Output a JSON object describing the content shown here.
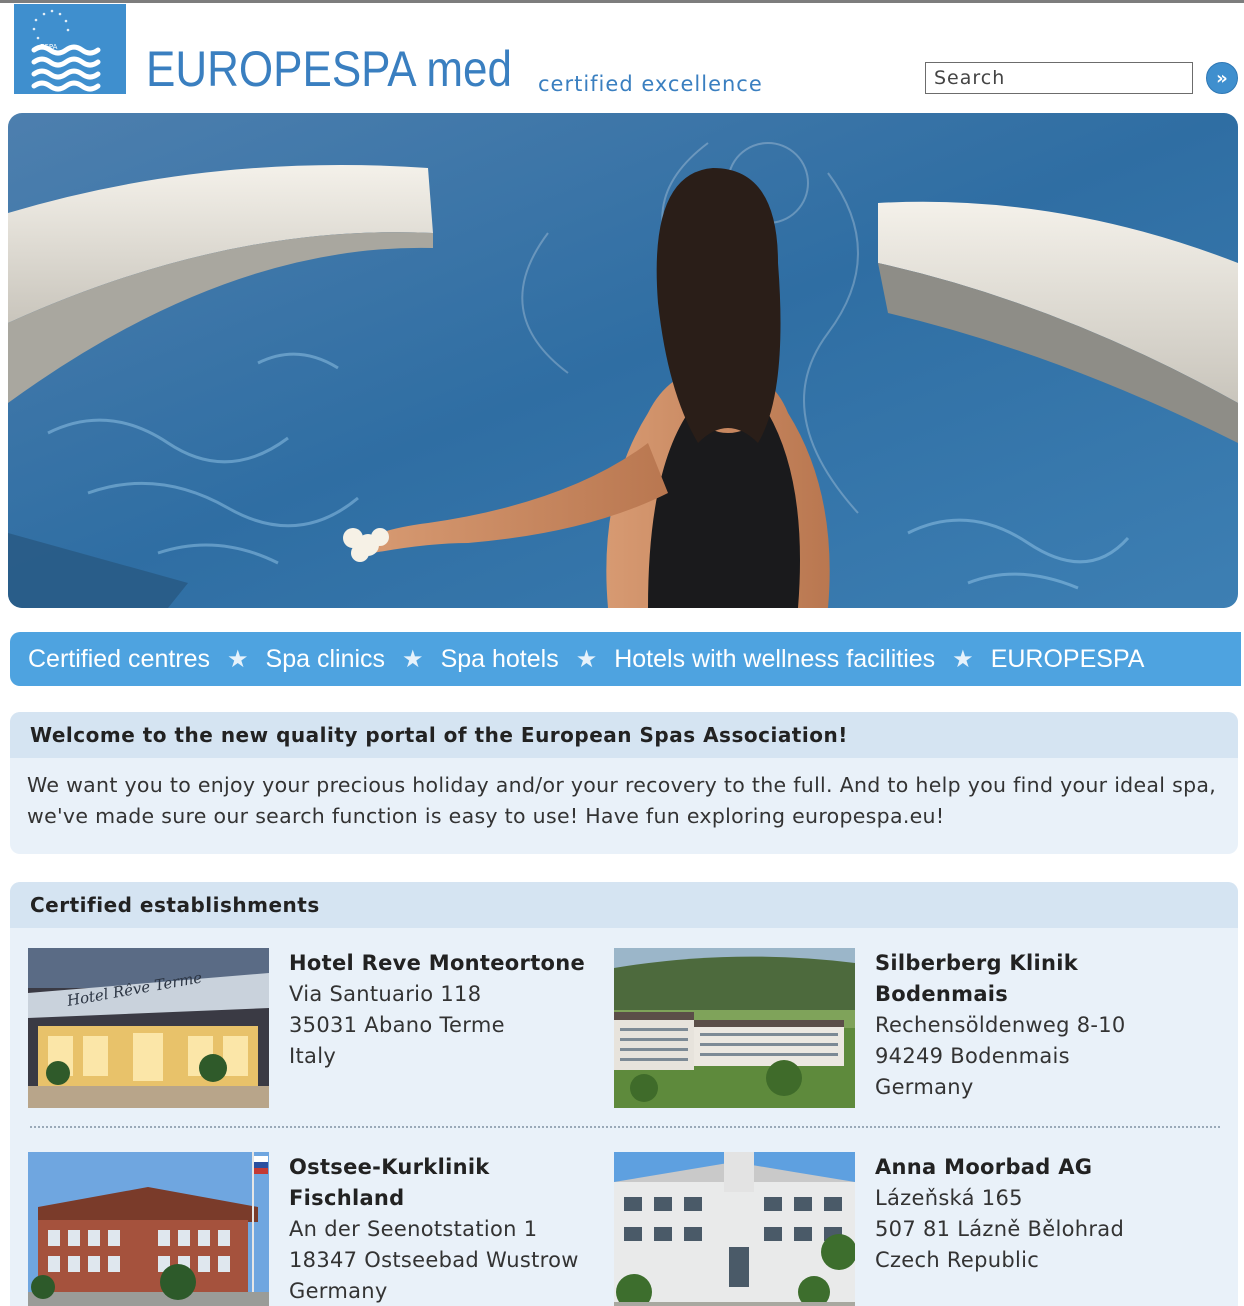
{
  "brand": {
    "title": "EUROPESPA med",
    "tagline": "certified excellence",
    "logo_text": "ESPA"
  },
  "search": {
    "placeholder": "Search",
    "button_label": "»"
  },
  "nav": {
    "items": [
      {
        "label": "Certified centres"
      },
      {
        "label": "Spa clinics"
      },
      {
        "label": "Spa hotels"
      },
      {
        "label": "Hotels with wellness facilities"
      },
      {
        "label": "EUROPESPA"
      }
    ],
    "separator": "★"
  },
  "welcome": {
    "heading": "Welcome to the new quality portal of the European Spas Association!",
    "body": "We want you to enjoy your precious holiday and/or your recovery to the full. And to help you find your ideal spa, we've made sure our search function is easy to use! Have fun exploring europespa.eu!"
  },
  "establishments": {
    "heading": "Certified establishments",
    "items": [
      {
        "name": "Hotel Reve Monteortone",
        "lines": [
          "Via Santuario 118",
          "35031 Abano Terme",
          "Italy"
        ],
        "sign_text": "Hotel Rêve Terme"
      },
      {
        "name": "Silberberg Klinik Bodenmais",
        "lines": [
          "Rechensöldenweg 8-10",
          "94249 Bodenmais",
          "Germany"
        ]
      },
      {
        "name": "Ostsee-Kurklinik Fischland",
        "lines": [
          "An der Seenotstation 1",
          "18347 Ostseebad Wustrow",
          "Germany"
        ]
      },
      {
        "name": "Anna Moorbad AG",
        "lines": [
          "Lázeňská 165",
          "507 81 Lázně Bělohrad",
          "Czech Republic"
        ]
      }
    ]
  },
  "colors": {
    "brand_blue": "#3a7fc0",
    "nav_blue": "#4ea3e0",
    "box_bg": "#e9f1f9",
    "box_head_bg": "#d5e4f2"
  }
}
